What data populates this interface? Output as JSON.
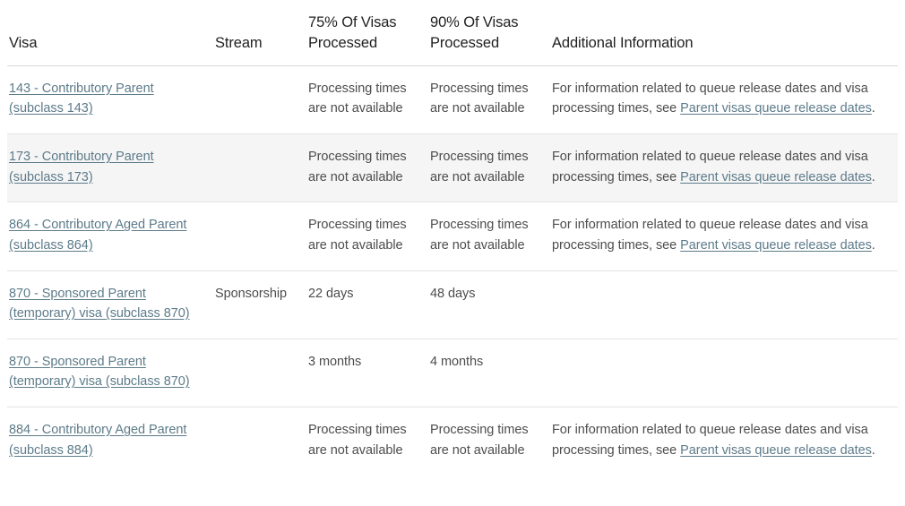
{
  "table": {
    "headers": {
      "visa": "Visa",
      "stream": "Stream",
      "p75": "75% Of Visas Processed",
      "p90": "90% Of Visas Processed",
      "additional": "Additional Information"
    },
    "rows": [
      {
        "visa_link": "143 - Contributory Parent (subclass 143)",
        "stream": "",
        "p75": "Processing times are not available",
        "p90": "Processing times are not available",
        "additional_prefix": "For information related to queue release dates and visa processing times, see ",
        "additional_link": "Parent visas queue release dates",
        "additional_suffix": ".",
        "shaded": false
      },
      {
        "visa_link": "173 - Contributory Parent (subclass 173)",
        "stream": "",
        "p75": "Processing times are not available",
        "p90": "Processing times are not available",
        "additional_prefix": "For information related to queue release dates and visa processing times, see ",
        "additional_link": "Parent visas queue release dates",
        "additional_suffix": ".",
        "shaded": true
      },
      {
        "visa_link": "864 - Contributory Aged Parent (subclass 864)",
        "stream": "",
        "p75": "Processing times are not available",
        "p90": "Processing times are not available",
        "additional_prefix": "For information related to queue release dates and visa processing times, see ",
        "additional_link": "Parent visas queue release dates",
        "additional_suffix": ".",
        "shaded": false
      },
      {
        "visa_link": "870 - Sponsored Parent (temporary) visa (subclass 870)",
        "stream": "Sponsorship",
        "p75": "22 days",
        "p90": "48 days",
        "additional_prefix": "",
        "additional_link": "",
        "additional_suffix": "",
        "shaded": false
      },
      {
        "visa_link": "870 - Sponsored Parent (temporary) visa (subclass 870)",
        "stream": "",
        "p75": "3 months",
        "p90": "4 months",
        "additional_prefix": "",
        "additional_link": "",
        "additional_suffix": "",
        "shaded": false
      },
      {
        "visa_link": "884 - Contributory Aged Parent (subclass 884)",
        "stream": "",
        "p75": "Processing times are not available",
        "p90": "Processing times are not available",
        "additional_prefix": "For information related to queue release dates and visa processing times, see ",
        "additional_link": "Parent visas queue release dates",
        "additional_suffix": ".",
        "shaded": false
      }
    ]
  },
  "colors": {
    "link": "#5d7b8a",
    "header_text": "#1f1f1f",
    "body_text": "#4d4d4d",
    "row_shaded_bg": "#f5f5f5",
    "divider": "#e4e4e4",
    "header_divider": "#d8d8d8"
  }
}
